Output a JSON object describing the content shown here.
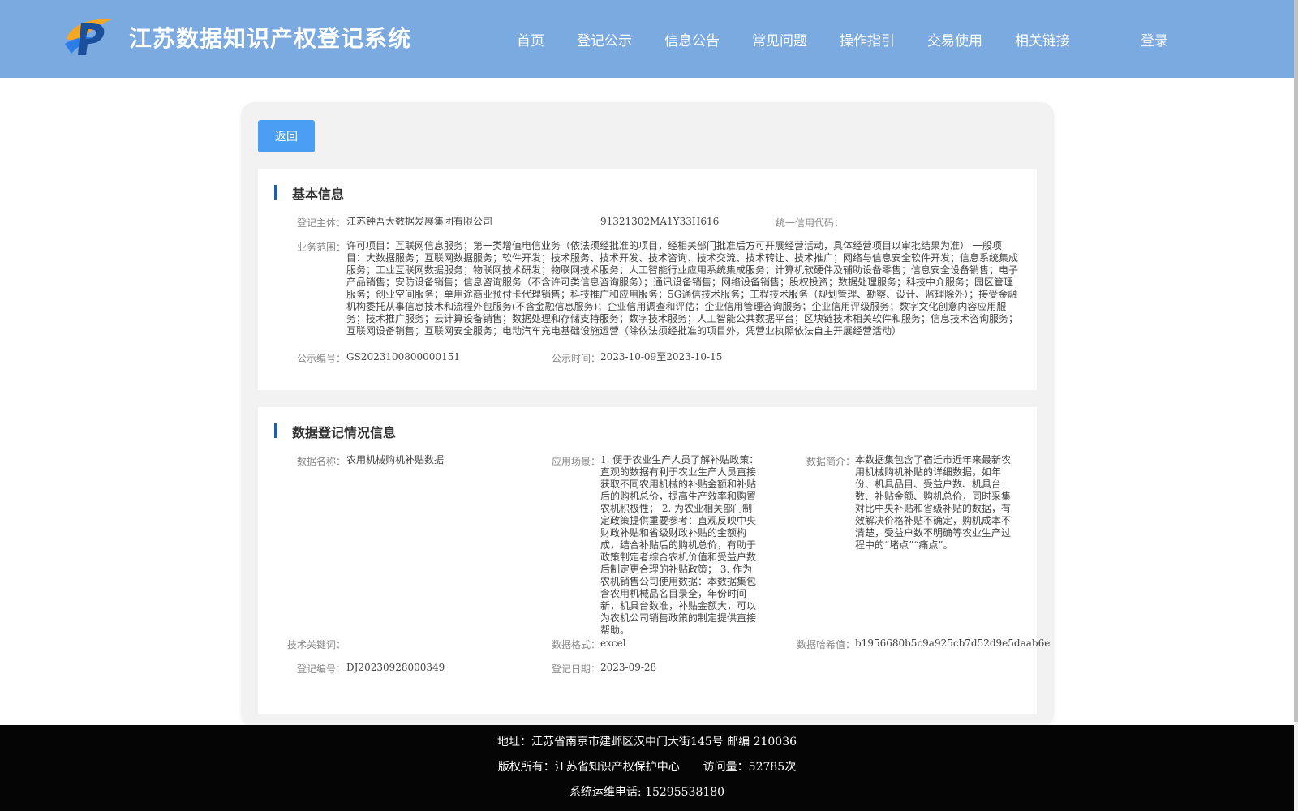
{
  "header": {
    "title": "江苏数据知识产权登记系统",
    "nav": [
      "首页",
      "登记公示",
      "信息公告",
      "常见问题",
      "操作指引",
      "交易使用",
      "相关链接"
    ],
    "login": "登录",
    "colors": {
      "header_bg": "#7aaae0",
      "primary": "#4a9ff5",
      "accent_bar": "#1f5fa8"
    }
  },
  "back_button": "返回",
  "basic_info": {
    "title": "基本信息",
    "subject_label": "登记主体：",
    "subject_value": "江苏钟吾大数据发展集团有限公司",
    "credit_label": "统一信用代码：",
    "credit_value": "91321302MA1Y33H616",
    "scope_label": "业务范围：",
    "scope_value": "许可项目：互联网信息服务；第一类增值电信业务（依法须经批准的项目，经相关部门批准后方可开展经营活动，具体经营项目以审批结果为准） 一般项目：大数据服务；互联网数据服务；软件开发；技术服务、技术开发、技术咨询、技术交流、技术转让、技术推广；网络与信息安全软件开发；信息系统集成服务；工业互联网数据服务；物联网技术研发；物联网技术服务；人工智能行业应用系统集成服务；计算机软硬件及辅助设备零售；信息安全设备销售；电子产品销售；安防设备销售；信息咨询服务（不含许可类信息咨询服务）；通讯设备销售；网络设备销售；股权投资；数据处理服务；科技中介服务；园区管理服务；创业空间服务；单用途商业预付卡代理销售；科技推广和应用服务；5G通信技术服务；工程技术服务（规划管理、勘察、设计、监理除外）；接受金融机构委托从事信息技术和流程外包服务(不含金融信息服务)；企业信用调查和评估；企业信用管理咨询服务；企业信用评级服务；数字文化创意内容应用服务；技术推广服务；云计算设备销售；数据处理和存储支持服务；数字技术服务；人工智能公共数据平台；区块链技术相关软件和服务；信息技术咨询服务；互联网设备销售；互联网安全服务；电动汽车充电基础设施运营（除依法须经批准的项目外，凭营业执照依法自主开展经营活动）",
    "pub_no_label": "公示编号：",
    "pub_no_value": "GS2023100800000151",
    "pub_time_label": "公示时间：",
    "pub_time_value": "2023-10-09至2023-10-15"
  },
  "data_info": {
    "title": "数据登记情况信息",
    "name_label": "数据名称：",
    "name_value": "农用机械购机补贴数据",
    "scene_label": "应用场景：",
    "scene_value": "1. 便于农业生产人员了解补贴政策：直观的数据有利于农业生产人员直接获取不同农用机械的补贴金额和补贴后的购机总价，提高生产效率和购置农机积极性； 2. 为农业相关部门制定政策提供重要参考：直观反映中央财政补贴和省级财政补贴的金额构成，结合补贴后的购机总价，有助于政策制定者综合农机价值和受益户数后制定更合理的补贴政策； 3. 作为农机销售公司使用数据：本数据集包含农用机械品名目录全，年份时间新，机具台数准，补贴金额大，可以为农机公司销售政策的制定提供直接帮助。",
    "intro_label": "数据简介：",
    "intro_value": "本数据集包含了宿迁市近年来最新农用机械购机补贴的详细数据，如年份、机具品目、受益户数、机具台数、补贴金额、购机总价，同时采集对比中央补贴和省级补贴的数据，有效解决价格补贴不确定，购机成本不清楚，受益户数不明确等农业生产过程中的“堵点”“痛点”。",
    "keywords_label": "技术关键词：",
    "keywords_value": "",
    "format_label": "数据格式：",
    "format_value": "excel",
    "hash_label": "数据哈希值：",
    "hash_value": "b1956680b5c9a925cb7d52d9e5daab6e",
    "reg_no_label": "登记编号：",
    "reg_no_value": "DJ20230928000349",
    "reg_date_label": "登记日期：",
    "reg_date_value": "2023-09-28"
  },
  "footer": {
    "address": "地址：江苏省南京市建邺区汉中门大街145号 邮编 210036",
    "copyright": "版权所有：江苏省知识产权保护中心",
    "visits_label": "访问量：",
    "visits_value": "52785次",
    "phone": "系统运维电话: 15295538180"
  }
}
